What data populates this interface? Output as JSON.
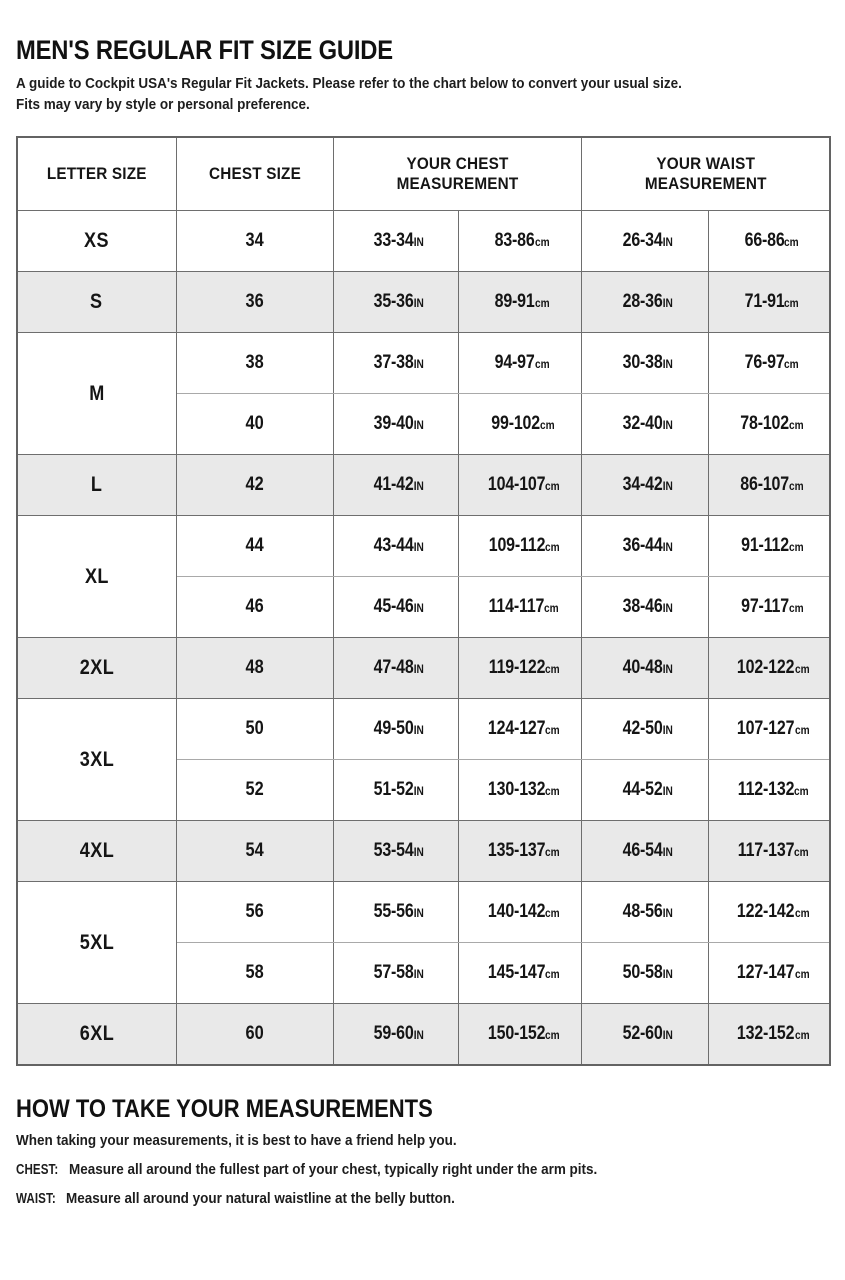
{
  "header": {
    "title": "MEN'S REGULAR FIT SIZE GUIDE",
    "intro_line1": "A guide to Cockpit USA's Regular Fit Jackets. Please refer to the chart below to convert your usual size.",
    "intro_line2": "Fits may vary by style or personal preference."
  },
  "table": {
    "columns": [
      {
        "key": "letter_size",
        "label": "LETTER SIZE",
        "label_line1": "LETTER SIZE",
        "label_line2": ""
      },
      {
        "key": "chest_size",
        "label": "CHEST SIZE",
        "label_line1": "CHEST SIZE",
        "label_line2": ""
      },
      {
        "key": "your_chest",
        "label": "YOUR CHEST MEASUREMENT",
        "label_line1": "YOUR CHEST",
        "label_line2": "MEASUREMENT"
      },
      {
        "key": "your_waist",
        "label": "YOUR WAIST MEASUREMENT",
        "label_line1": "YOUR WAIST",
        "label_line2": "MEASUREMENT"
      }
    ],
    "units": {
      "inch": "IN",
      "cm": "cm"
    },
    "groups": [
      {
        "letter": "XS",
        "shaded": false,
        "rows": [
          {
            "chest_size": "34",
            "chest_in": "33-34",
            "chest_cm": "83-86",
            "waist_in": "26-34",
            "waist_cm": "66-86"
          }
        ]
      },
      {
        "letter": "S",
        "shaded": true,
        "rows": [
          {
            "chest_size": "36",
            "chest_in": "35-36",
            "chest_cm": "89-91",
            "waist_in": "28-36",
            "waist_cm": "71-91"
          }
        ]
      },
      {
        "letter": "M",
        "shaded": false,
        "rows": [
          {
            "chest_size": "38",
            "chest_in": "37-38",
            "chest_cm": "94-97",
            "waist_in": "30-38",
            "waist_cm": "76-97"
          },
          {
            "chest_size": "40",
            "chest_in": "39-40",
            "chest_cm": "99-102",
            "waist_in": "32-40",
            "waist_cm": "78-102"
          }
        ]
      },
      {
        "letter": "L",
        "shaded": true,
        "rows": [
          {
            "chest_size": "42",
            "chest_in": "41-42",
            "chest_cm": "104-107",
            "waist_in": "34-42",
            "waist_cm": "86-107"
          }
        ]
      },
      {
        "letter": "XL",
        "shaded": false,
        "rows": [
          {
            "chest_size": "44",
            "chest_in": "43-44",
            "chest_cm": "109-112",
            "waist_in": "36-44",
            "waist_cm": "91-112"
          },
          {
            "chest_size": "46",
            "chest_in": "45-46",
            "chest_cm": "114-117",
            "waist_in": "38-46",
            "waist_cm": "97-117"
          }
        ]
      },
      {
        "letter": "2XL",
        "shaded": true,
        "rows": [
          {
            "chest_size": "48",
            "chest_in": "47-48",
            "chest_cm": "119-122",
            "waist_in": "40-48",
            "waist_cm": "102-122"
          }
        ]
      },
      {
        "letter": "3XL",
        "shaded": false,
        "rows": [
          {
            "chest_size": "50",
            "chest_in": "49-50",
            "chest_cm": "124-127",
            "waist_in": "42-50",
            "waist_cm": "107-127"
          },
          {
            "chest_size": "52",
            "chest_in": "51-52",
            "chest_cm": "130-132",
            "waist_in": "44-52",
            "waist_cm": "112-132"
          }
        ]
      },
      {
        "letter": "4XL",
        "shaded": true,
        "rows": [
          {
            "chest_size": "54",
            "chest_in": "53-54",
            "chest_cm": "135-137",
            "waist_in": "46-54",
            "waist_cm": "117-137"
          }
        ]
      },
      {
        "letter": "5XL",
        "shaded": false,
        "rows": [
          {
            "chest_size": "56",
            "chest_in": "55-56",
            "chest_cm": "140-142",
            "waist_in": "48-56",
            "waist_cm": "122-142"
          },
          {
            "chest_size": "58",
            "chest_in": "57-58",
            "chest_cm": "145-147",
            "waist_in": "50-58",
            "waist_cm": "127-147"
          }
        ]
      },
      {
        "letter": "6XL",
        "shaded": true,
        "rows": [
          {
            "chest_size": "60",
            "chest_in": "59-60",
            "chest_cm": "150-152",
            "waist_in": "52-60",
            "waist_cm": "132-152"
          }
        ]
      }
    ]
  },
  "howto": {
    "title": "HOW TO TAKE YOUR MEASUREMENTS",
    "intro": "When taking your measurements, it is best to have a friend help you.",
    "chest_label": "CHEST:",
    "chest_text": "Measure all around the fullest part of your chest, typically right under the arm pits.",
    "waist_label": "WAIST:",
    "waist_text": "Measure all around your natural waistline at the belly button."
  },
  "colors": {
    "shaded_row": "#e9e9e9",
    "border": "#6e6e6e",
    "outer_border": "#636363",
    "text": "#151515",
    "background": "#ffffff"
  }
}
